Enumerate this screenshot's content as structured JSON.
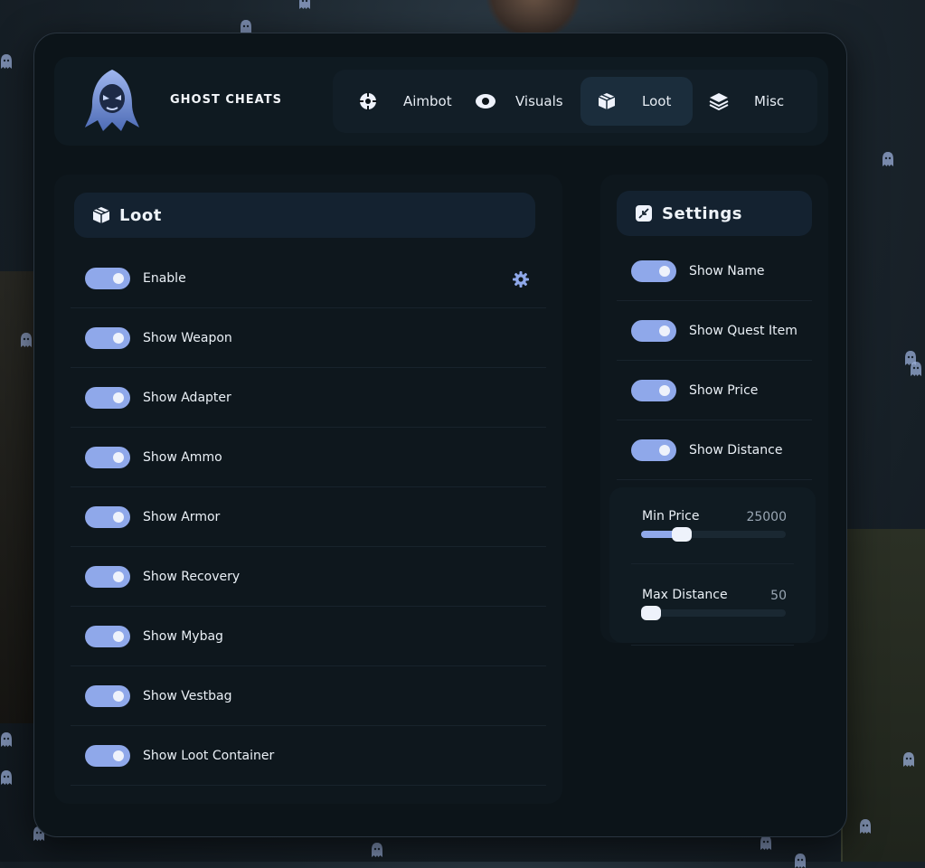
{
  "app": {
    "brand": "GHOST CHEATS"
  },
  "tabs": [
    {
      "label": "Aimbot",
      "icon": "crosshair-icon",
      "active": false
    },
    {
      "label": "Visuals",
      "icon": "eye-icon",
      "active": false
    },
    {
      "label": "Loot",
      "icon": "box-icon",
      "active": true
    },
    {
      "label": "Misc",
      "icon": "layers-icon",
      "active": false
    }
  ],
  "loot": {
    "title": "Loot",
    "items": [
      {
        "label": "Enable",
        "on": true
      },
      {
        "label": "Show Weapon",
        "on": true
      },
      {
        "label": "Show Adapter",
        "on": true
      },
      {
        "label": "Show Ammo",
        "on": true
      },
      {
        "label": "Show Armor",
        "on": true
      },
      {
        "label": "Show Recovery",
        "on": true
      },
      {
        "label": "Show Mybag",
        "on": true
      },
      {
        "label": "Show Vestbag",
        "on": true
      },
      {
        "label": "Show Loot Container",
        "on": true
      }
    ]
  },
  "settings": {
    "title": "Settings",
    "items": [
      {
        "label": "Show Name",
        "on": true
      },
      {
        "label": "Show Quest Item",
        "on": true
      },
      {
        "label": "Show Price",
        "on": true
      },
      {
        "label": "Show Distance",
        "on": true
      }
    ],
    "min_price": {
      "label": "Min Price",
      "value": "25000",
      "fraction": 0.28
    },
    "max_distance": {
      "label": "Max Distance",
      "value": "50",
      "fraction": 0.05
    }
  },
  "colors": {
    "accent": "#8fa8ea",
    "window_bg": "#0c1419",
    "active_tab": "#1b2d3c"
  }
}
